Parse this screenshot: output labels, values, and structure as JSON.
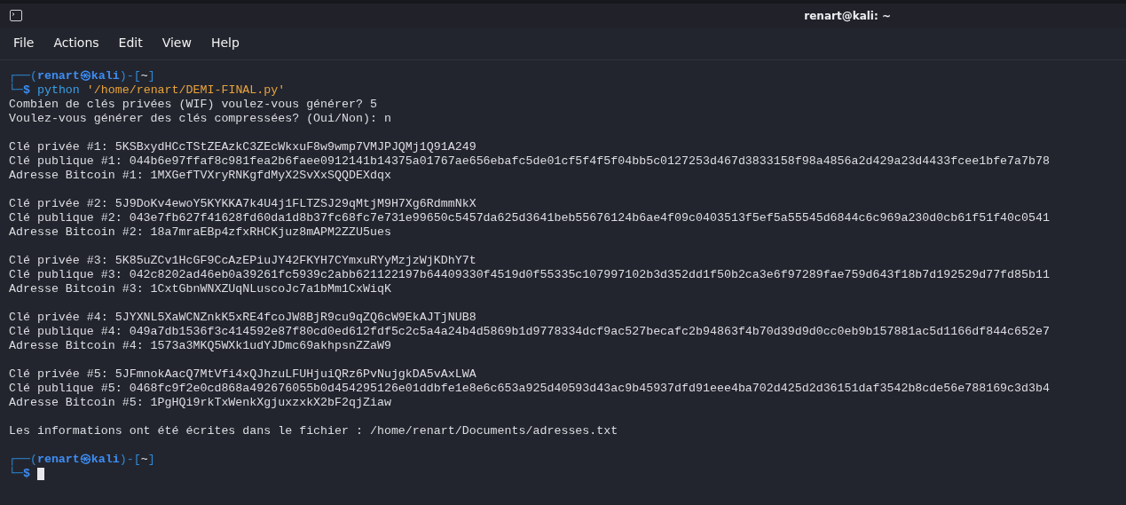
{
  "window": {
    "title": "renart@kali: ~"
  },
  "menu": [
    "File",
    "Actions",
    "Edit",
    "View",
    "Help"
  ],
  "terminal": {
    "lines": [
      {
        "kind": "prompt",
        "open": "┌──(",
        "user_host": "renart㉿kali",
        "mid": ")-[",
        "dir": "~",
        "close": "]"
      },
      {
        "kind": "command",
        "corner": "└─",
        "sign": "$",
        "program": "python",
        "argument": "'/home/renart/DEMI-FINAL.py'",
        "cursor": false
      },
      {
        "kind": "output",
        "text": "Combien de clés privées (WIF) voulez-vous générer? 5"
      },
      {
        "kind": "output",
        "text": "Voulez-vous générer des clés compressées? (Oui/Non): n"
      },
      {
        "kind": "blank"
      },
      {
        "kind": "output",
        "text": "Clé privée #1: 5KSBxydHCcTStZEAzkC3ZEcWkxuF8w9wmp7VMJPJQMj1Q91A249"
      },
      {
        "kind": "output",
        "text": "Clé publique #1: 044b6e97ffaf8c981fea2b6faee0912141b14375a01767ae656ebafc5de01cf5f4f5f04bb5c0127253d467d3833158f98a4856a2d429a23d4433fcee1bfe7a7b78"
      },
      {
        "kind": "output",
        "text": "Adresse Bitcoin #1: 1MXGefTVXryRNKgfdMyX2SvXxSQQDEXdqx"
      },
      {
        "kind": "blank"
      },
      {
        "kind": "output",
        "text": "Clé privée #2: 5J9DoKv4ewoY5KYKKA7k4U4j1FLTZSJ29qMtjM9H7Xg6RdmmNkX"
      },
      {
        "kind": "output",
        "text": "Clé publique #2: 043e7fb627f41628fd60da1d8b37fc68fc7e731e99650c5457da625d3641beb55676124b6ae4f09c0403513f5ef5a55545d6844c6c969a230d0cb61f51f40c0541"
      },
      {
        "kind": "output",
        "text": "Adresse Bitcoin #2: 18a7mraEBp4zfxRHCKjuz8mAPM2ZZU5ues"
      },
      {
        "kind": "blank"
      },
      {
        "kind": "output",
        "text": "Clé privée #3: 5K85uZCv1HcGF9CcAzEPiuJY42FKYH7CYmxuRYyMzjzWjKDhY7t"
      },
      {
        "kind": "output",
        "text": "Clé publique #3: 042c8202ad46eb0a39261fc5939c2abb621122197b64409330f4519d0f55335c107997102b3d352dd1f50b2ca3e6f97289fae759d643f18b7d192529d77fd85b11"
      },
      {
        "kind": "output",
        "text": "Adresse Bitcoin #3: 1CxtGbnWNXZUqNLuscoJc7a1bMm1CxWiqK"
      },
      {
        "kind": "blank"
      },
      {
        "kind": "output",
        "text": "Clé privée #4: 5JYXNL5XaWCNZnkK5xRE4fcoJW8BjR9cu9qZQ6cW9EkAJTjNUB8"
      },
      {
        "kind": "output",
        "text": "Clé publique #4: 049a7db1536f3c414592e87f80cd0ed612fdf5c2c5a4a24b4d5869b1d9778334dcf9ac527becafc2b94863f4b70d39d9d0cc0eb9b157881ac5d1166df844c652e7"
      },
      {
        "kind": "output",
        "text": "Adresse Bitcoin #4: 1573a3MKQ5WXk1udYJDmc69akhpsnZZaW9"
      },
      {
        "kind": "blank"
      },
      {
        "kind": "output",
        "text": "Clé privée #5: 5JFmnokAacQ7MtVfi4xQJhzuLFUHjuiQRz6PvNujgkDA5vAxLWA"
      },
      {
        "kind": "output",
        "text": "Clé publique #5: 0468fc9f2e0cd868a492676055b0d454295126e01ddbfe1e8e6c653a925d40593d43ac9b45937dfd91eee4ba702d425d2d36151daf3542b8cde56e788169c3d3b4"
      },
      {
        "kind": "output",
        "text": "Adresse Bitcoin #5: 1PgHQi9rkTxWenkXgjuxzxkX2bF2qjZiaw"
      },
      {
        "kind": "blank"
      },
      {
        "kind": "output",
        "text": "Les informations ont été écrites dans le fichier : /home/renart/Documents/adresses.txt"
      },
      {
        "kind": "blank"
      },
      {
        "kind": "prompt",
        "open": "┌──(",
        "user_host": "renart㉿kali",
        "mid": ")-[",
        "dir": "~",
        "close": "]"
      },
      {
        "kind": "command",
        "corner": "└─",
        "sign": "$",
        "cursor": true
      }
    ]
  }
}
